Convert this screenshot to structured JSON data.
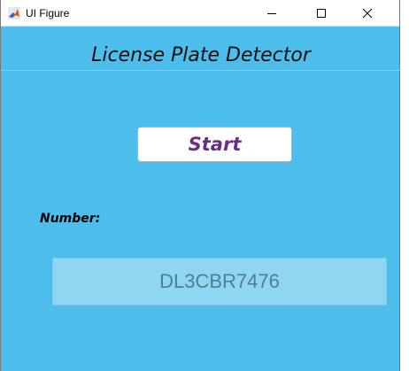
{
  "window": {
    "title": "UI Figure",
    "icons": {
      "app": "matlab-icon",
      "minimize": "minimize-icon",
      "maximize": "maximize-icon",
      "close": "close-icon"
    }
  },
  "app": {
    "heading": "License Plate Detector",
    "start_label": "Start",
    "number_label": "Number:",
    "plate_value": "DL3CBR7476"
  },
  "colors": {
    "background": "#4dbdec",
    "button_text": "#6a2c86",
    "field_background": "#8fd6f3",
    "field_text": "#4a7f98"
  }
}
